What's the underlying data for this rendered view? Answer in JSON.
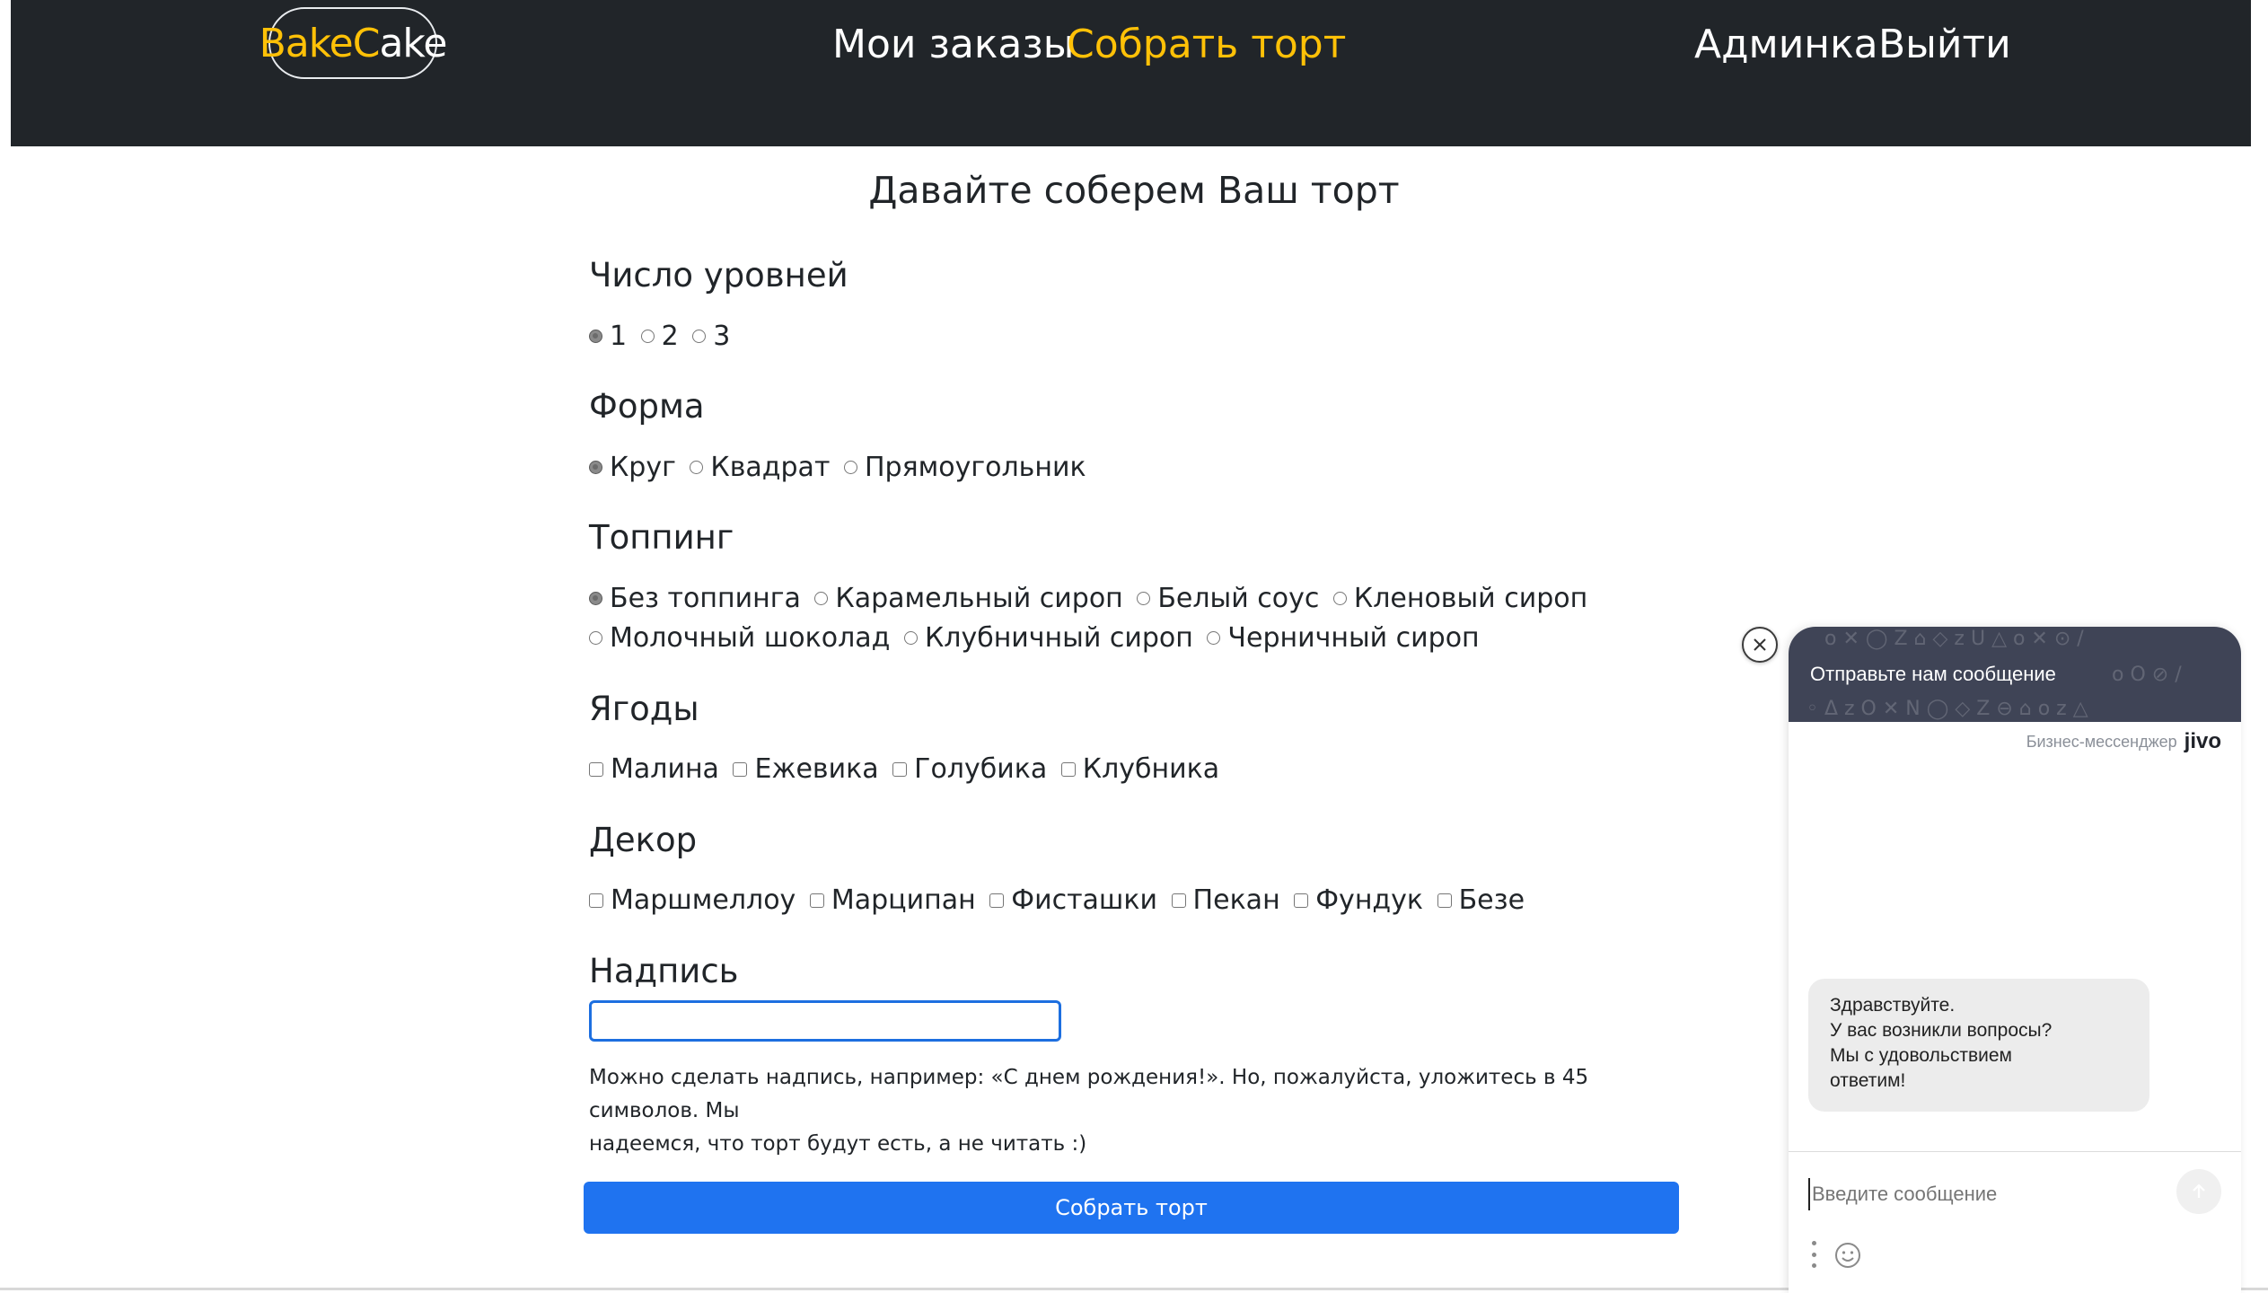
{
  "header": {
    "logo": {
      "part1": "Bake",
      "part2": "Cake"
    },
    "nav": {
      "orders": "Мои заказы",
      "build": "Собрать торт",
      "admin": "Админка",
      "logout": "Выйти"
    }
  },
  "form": {
    "title": "Давайте соберем Ваш торт",
    "levels": {
      "label": "Число уровней",
      "options": [
        "1",
        "2",
        "3"
      ],
      "selected": "1"
    },
    "shape": {
      "label": "Форма",
      "options": [
        "Круг",
        "Квадрат",
        "Прямоугольник"
      ],
      "selected": "Круг"
    },
    "topping": {
      "label": "Топпинг",
      "options": [
        "Без топпинга",
        "Карамельный сироп",
        "Белый соус",
        "Кленовый сироп",
        "Молочный шоколад",
        "Клубничный сироп",
        "Черничный сироп"
      ],
      "selected": "Без топпинга"
    },
    "berries": {
      "label": "Ягоды",
      "options": [
        "Малина",
        "Ежевика",
        "Голубика",
        "Клубника"
      ]
    },
    "decor": {
      "label": "Декор",
      "options": [
        "Маршмеллоу",
        "Марципан",
        "Фисташки",
        "Пекан",
        "Фундук",
        "Безе"
      ]
    },
    "inscription": {
      "label": "Надпись",
      "value": "",
      "hint_line1": "Можно сделать надпись, например: «С днем рождения!». Но, пожалуйста, уложитесь в 45 символов. Мы",
      "hint_line2": "надеемся, что торт будут есть, а не читать :)"
    },
    "submit_label": "Собрать торт"
  },
  "chat": {
    "header_text": "Отправьте нам сообщение",
    "brand_text": "Бизнес-мессенджер",
    "brand_logo": "jivo",
    "greeting": [
      "Здравствуйте.",
      "У вас возникли вопросы?",
      "Мы с удовольствием",
      "ответим!"
    ],
    "input_placeholder": "Введите сообщение",
    "icons": {
      "close": "close-icon",
      "send": "arrow-up-icon",
      "more": "more-vertical-icon",
      "emoji": "smile-icon"
    }
  },
  "colors": {
    "header_bg": "#212529",
    "accent": "#ffc107",
    "primary": "#1f73f0",
    "chat_header": "#3f4456"
  }
}
